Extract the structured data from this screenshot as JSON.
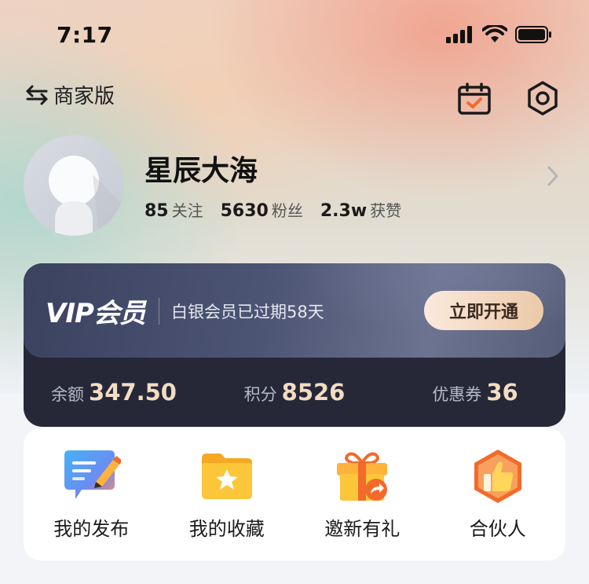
{
  "status_bar": {
    "time": "7:17"
  },
  "topbar": {
    "switch_label": "商家版"
  },
  "profile": {
    "username": "星辰大海",
    "stats": [
      {
        "value": "85",
        "label": "关注"
      },
      {
        "value": "5630",
        "label": "粉丝"
      },
      {
        "value": "2.3w",
        "label": "获赞"
      }
    ]
  },
  "vip": {
    "title": "VIP会员",
    "subtitle": "白银会员已过期58天",
    "button": "立即开通",
    "metrics": [
      {
        "label": "余额",
        "value": "347.50"
      },
      {
        "label": "积分",
        "value": "8526"
      },
      {
        "label": "优惠券",
        "value": "36"
      }
    ]
  },
  "menu": [
    {
      "label": "我的发布",
      "icon": "publish-icon"
    },
    {
      "label": "我的收藏",
      "icon": "favorites-folder-icon"
    },
    {
      "label": "邀新有礼",
      "icon": "gift-box-icon"
    },
    {
      "label": "合伙人",
      "icon": "thumbs-up-badge-icon"
    }
  ],
  "colors": {
    "accent_orange": "#f26b2a",
    "vip_dark": "#262838",
    "vip_gold": "#f3dcc3"
  }
}
